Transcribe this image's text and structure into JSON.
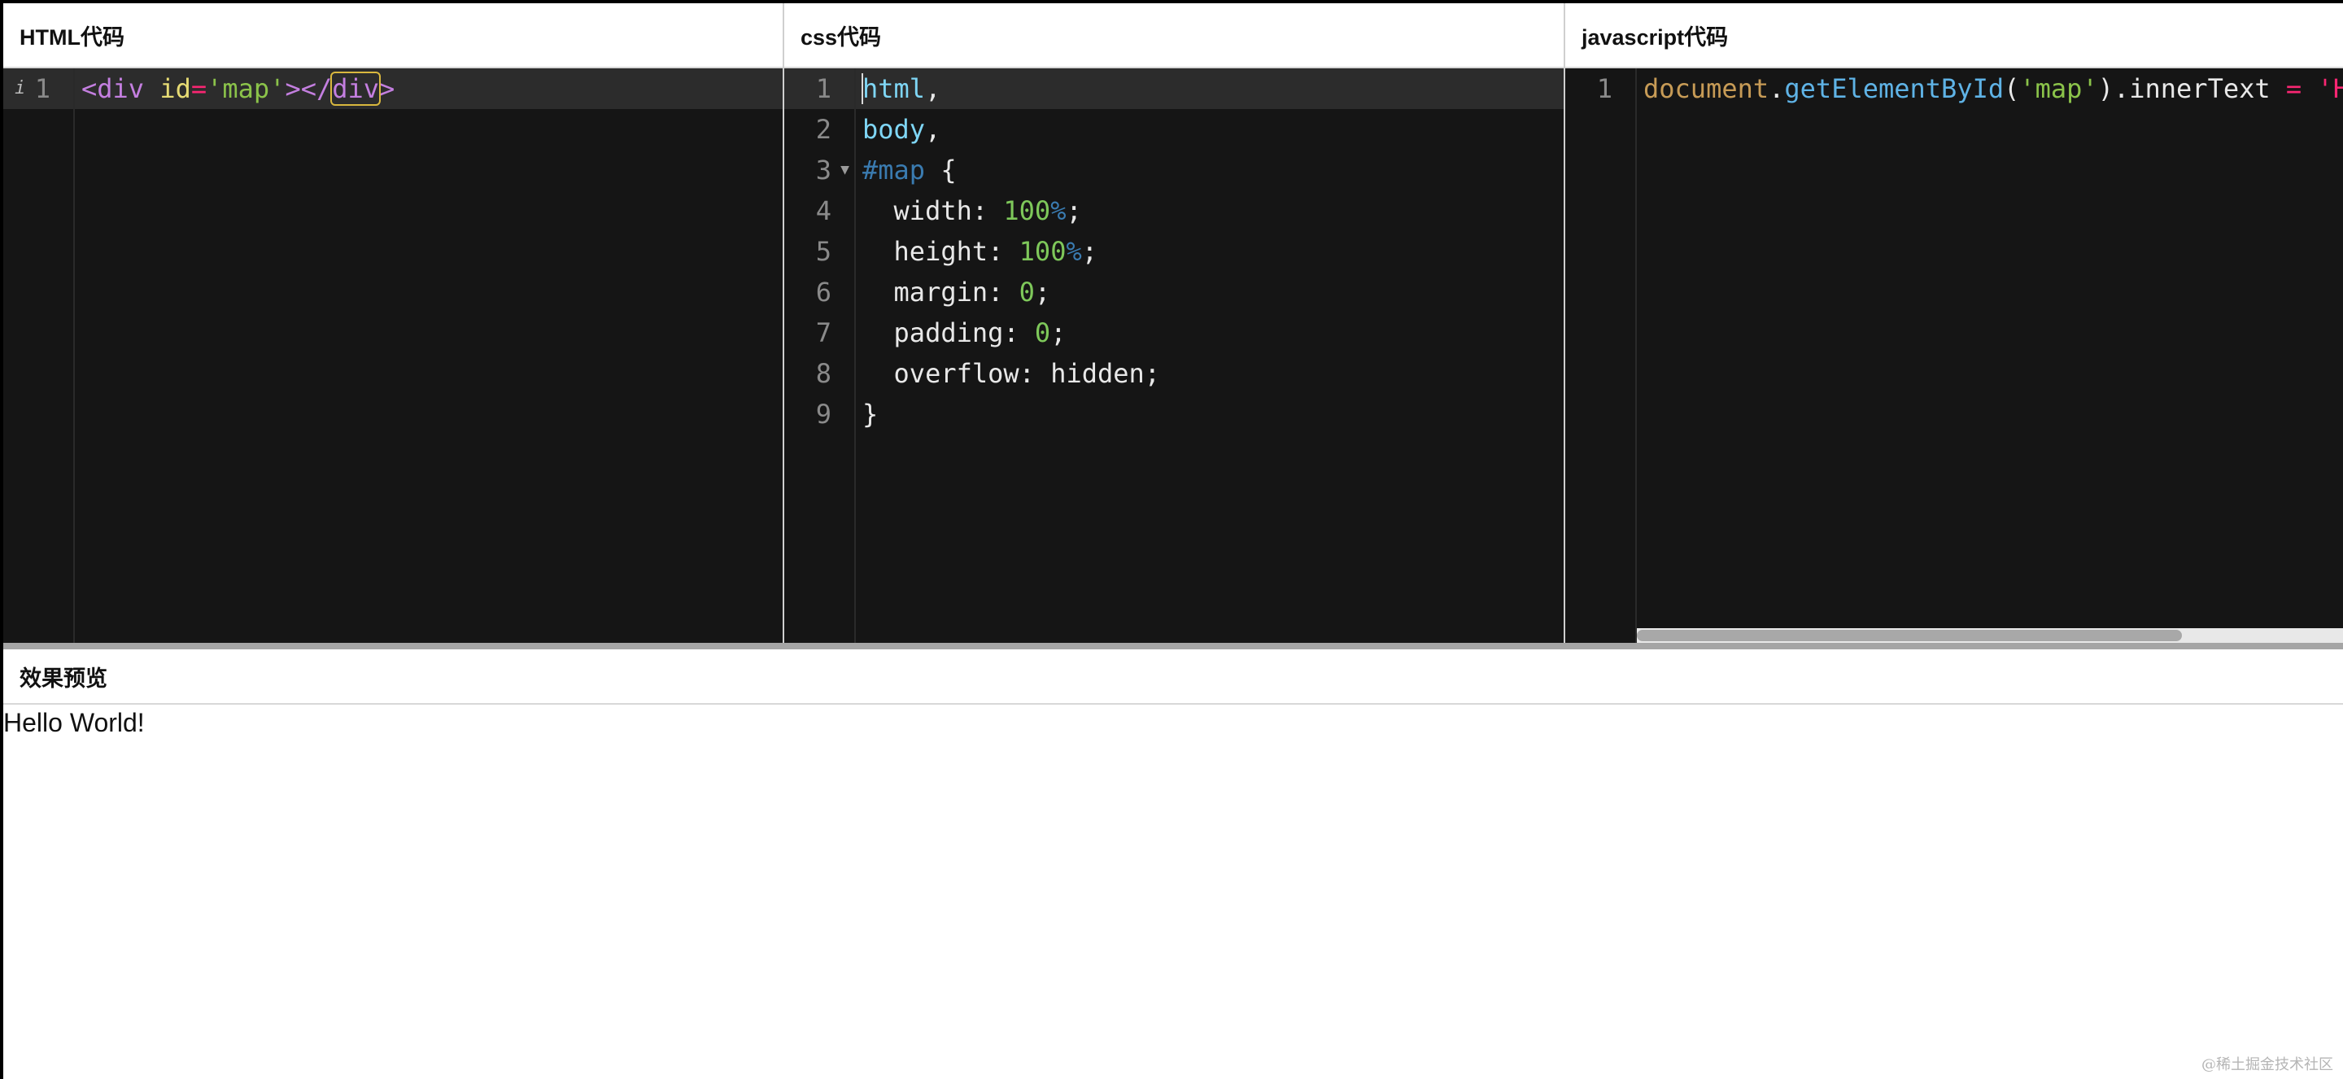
{
  "panels": {
    "html": {
      "title": "HTML代码"
    },
    "css": {
      "title": "css代码"
    },
    "js": {
      "title": "javascript代码"
    }
  },
  "html_code": {
    "line_numbers": [
      "1"
    ],
    "tokens": {
      "open_lt": "<",
      "tag_div": "div",
      "attr_id": " id",
      "eq": "=",
      "val_map": "'map'",
      "close_open": "></",
      "tag_div_close": "div",
      "gt": ">"
    }
  },
  "css_code": {
    "line_numbers": [
      "1",
      "2",
      "3",
      "4",
      "5",
      "6",
      "7",
      "8",
      "9"
    ],
    "l1_sel": "html",
    "l1_comma": ",",
    "l2_sel": "body",
    "l2_comma": ",",
    "l3_hash": "#map",
    "l3_brace": " {",
    "l4_prop": "  width: ",
    "l4_num": "100",
    "l4_pct": "%",
    "l4_end": ";",
    "l5_prop": "  height: ",
    "l5_num": "100",
    "l5_pct": "%",
    "l5_end": ";",
    "l6_prop": "  margin: ",
    "l6_num": "0",
    "l6_end": ";",
    "l7_prop": "  padding: ",
    "l7_num": "0",
    "l7_end": ";",
    "l8_text": "  overflow: hidden;",
    "l9_text": "}"
  },
  "js_code": {
    "line_numbers": [
      "1"
    ],
    "obj": "document",
    "dot1": ".",
    "fn": "getElementById",
    "paren_open": "(",
    "arg": "'map'",
    "paren_close_prop": ").innerText",
    "op": " = ",
    "str_partial": "'H"
  },
  "preview": {
    "title": "效果预览",
    "output": "Hello World!"
  },
  "watermark": "@稀土掘金技术社区",
  "colors": {
    "editor_bg": "#151515",
    "active_line": "#2c2c2c",
    "tag": "#c47fe0",
    "attribute": "#e6db74",
    "string": "#8bc34a",
    "selector": "#7fd6f5",
    "number": "#7ec85a"
  }
}
